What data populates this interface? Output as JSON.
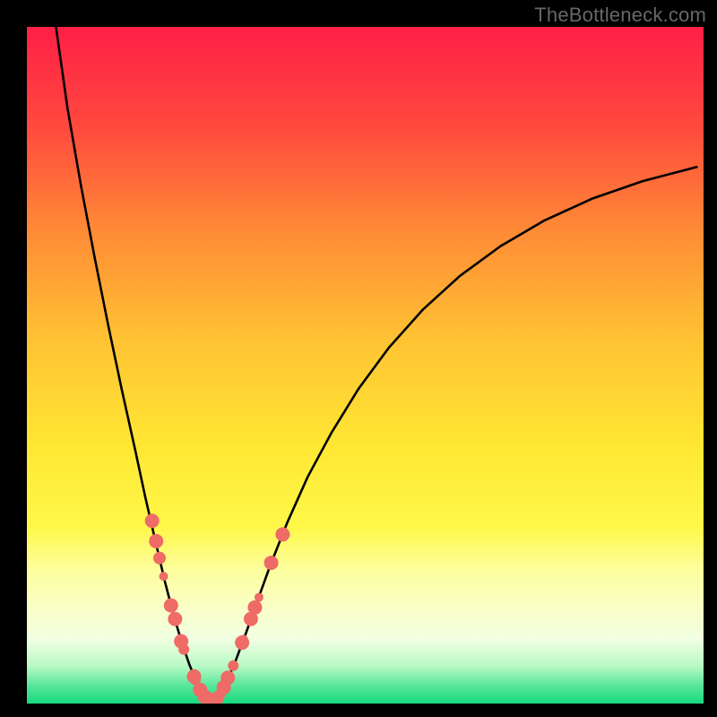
{
  "watermark": "TheBottleneck.com",
  "chart_data": {
    "type": "line",
    "title": "",
    "xlabel": "",
    "ylabel": "",
    "xlim": [
      0,
      100
    ],
    "ylim": [
      0,
      100
    ],
    "grid": false,
    "legend": false,
    "background_gradient": {
      "stops": [
        {
          "pos": 0.0,
          "color": "#ff1f47"
        },
        {
          "pos": 0.15,
          "color": "#ff4a3e"
        },
        {
          "pos": 0.3,
          "color": "#ff8a36"
        },
        {
          "pos": 0.46,
          "color": "#ffc233"
        },
        {
          "pos": 0.62,
          "color": "#ffe733"
        },
        {
          "pos": 0.74,
          "color": "#fff84a"
        },
        {
          "pos": 0.8,
          "color": "#fdfe9b"
        },
        {
          "pos": 0.86,
          "color": "#faffc8"
        },
        {
          "pos": 0.905,
          "color": "#f1ffe2"
        },
        {
          "pos": 0.945,
          "color": "#b7f9c4"
        },
        {
          "pos": 0.975,
          "color": "#54e598"
        },
        {
          "pos": 1.0,
          "color": "#18d880"
        }
      ]
    },
    "series": [
      {
        "name": "left-curve",
        "color": "#000000",
        "x": [
          4.3,
          6.0,
          8.0,
          10.0,
          12.0,
          14.0,
          16.0,
          17.5,
          19.0,
          20.4,
          21.7,
          22.9,
          24.0,
          25.0,
          25.9,
          26.7,
          27.4
        ],
        "y": [
          100.0,
          88.0,
          76.5,
          66.0,
          56.0,
          46.5,
          37.5,
          30.5,
          24.0,
          18.0,
          13.0,
          9.0,
          5.8,
          3.4,
          1.8,
          0.8,
          0.15
        ]
      },
      {
        "name": "right-curve",
        "color": "#000000",
        "x": [
          27.4,
          28.4,
          29.5,
          30.8,
          32.3,
          34.0,
          36.0,
          38.5,
          41.5,
          45.0,
          49.0,
          53.5,
          58.5,
          64.0,
          70.0,
          76.5,
          83.5,
          91.0,
          99.0
        ],
        "y": [
          0.15,
          1.2,
          3.2,
          6.2,
          10.2,
          15.0,
          20.5,
          26.8,
          33.5,
          40.0,
          46.5,
          52.6,
          58.2,
          63.2,
          67.6,
          71.4,
          74.6,
          77.2,
          79.3
        ]
      }
    ],
    "scatter": {
      "name": "highlight-points",
      "color": "#ee6b66",
      "radius_major": 8,
      "radius_minor": 5,
      "points": [
        {
          "x": 18.5,
          "y": 27.0,
          "r": 8
        },
        {
          "x": 19.1,
          "y": 24.0,
          "r": 8
        },
        {
          "x": 19.6,
          "y": 21.5,
          "r": 7
        },
        {
          "x": 20.2,
          "y": 18.8,
          "r": 5
        },
        {
          "x": 21.3,
          "y": 14.5,
          "r": 8
        },
        {
          "x": 21.9,
          "y": 12.5,
          "r": 8
        },
        {
          "x": 22.8,
          "y": 9.2,
          "r": 8
        },
        {
          "x": 23.2,
          "y": 8.0,
          "r": 6
        },
        {
          "x": 24.7,
          "y": 4.0,
          "r": 8
        },
        {
          "x": 24.9,
          "y": 3.5,
          "r": 6
        },
        {
          "x": 25.6,
          "y": 2.0,
          "r": 8
        },
        {
          "x": 26.3,
          "y": 1.0,
          "r": 8
        },
        {
          "x": 26.8,
          "y": 0.6,
          "r": 6
        },
        {
          "x": 27.4,
          "y": 0.3,
          "r": 8
        },
        {
          "x": 28.0,
          "y": 0.7,
          "r": 8
        },
        {
          "x": 28.6,
          "y": 1.4,
          "r": 6
        },
        {
          "x": 29.1,
          "y": 2.4,
          "r": 8
        },
        {
          "x": 29.7,
          "y": 3.8,
          "r": 8
        },
        {
          "x": 30.5,
          "y": 5.6,
          "r": 6
        },
        {
          "x": 31.8,
          "y": 9.0,
          "r": 8
        },
        {
          "x": 32.0,
          "y": 9.5,
          "r": 5
        },
        {
          "x": 33.1,
          "y": 12.5,
          "r": 8
        },
        {
          "x": 33.7,
          "y": 14.2,
          "r": 8
        },
        {
          "x": 34.3,
          "y": 15.7,
          "r": 5
        },
        {
          "x": 36.1,
          "y": 20.8,
          "r": 8
        },
        {
          "x": 37.8,
          "y": 25.0,
          "r": 8
        }
      ]
    }
  }
}
